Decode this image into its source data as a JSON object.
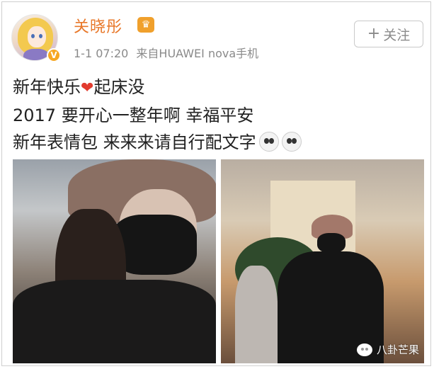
{
  "user": {
    "name": "关晓彤",
    "verified_badge": "V",
    "crown_icon": "crown-badge-icon",
    "time": "1-1 07:20",
    "source": "来自HUAWEI nova手机"
  },
  "follow_button": {
    "plus": "+",
    "label": "关注"
  },
  "post": {
    "line1_a": "新年快乐",
    "heart": "❤",
    "line1_b": "起床没",
    "line2": "2017 要开心一整年啊 幸福平安",
    "line3": "新年表情包 来来来请自行配文字"
  },
  "watermark": {
    "text": "八卦芒果"
  },
  "colors": {
    "username": "#e8782a",
    "badge": "#f6a723",
    "meta": "#8a8a8a",
    "heart": "#e23b2e"
  }
}
